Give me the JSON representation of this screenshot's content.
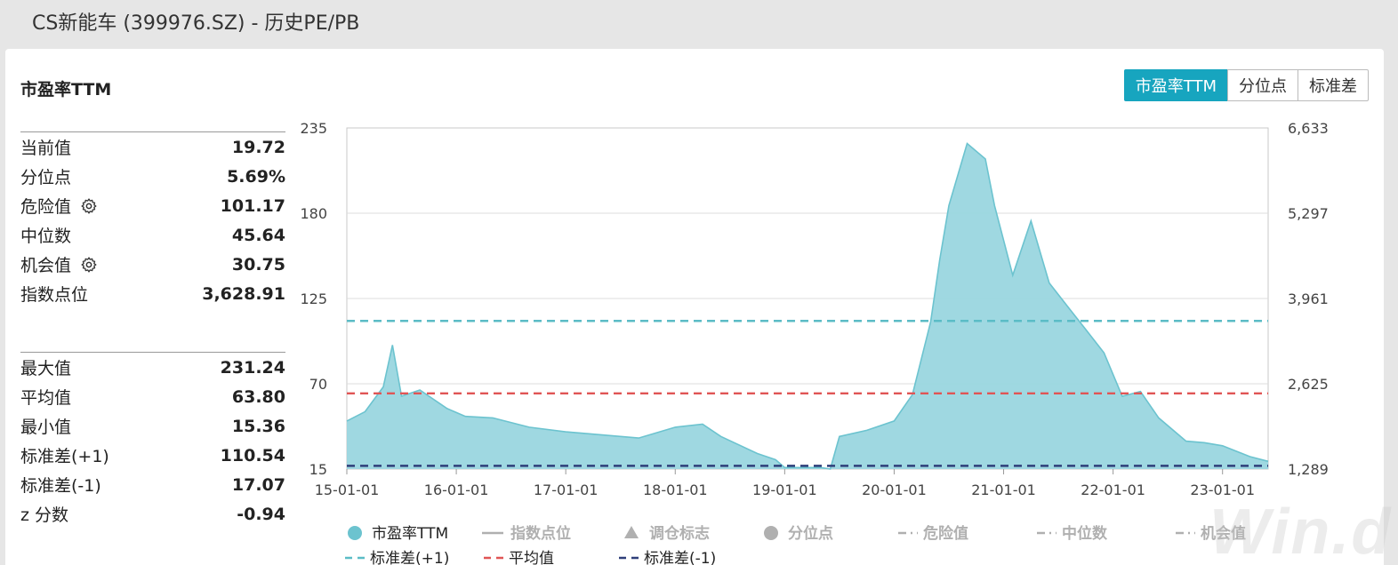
{
  "page": {
    "title": "CS新能车 (399976.SZ) - 历史PE/PB"
  },
  "panel": {
    "title": "市盈率TTM",
    "stats_top": [
      {
        "label": "当前值",
        "value": "19.72",
        "gear": false
      },
      {
        "label": "分位点",
        "value": "5.69%",
        "gear": false
      },
      {
        "label": "危险值",
        "value": "101.17",
        "gear": true
      },
      {
        "label": "中位数",
        "value": "45.64",
        "gear": false
      },
      {
        "label": "机会值",
        "value": "30.75",
        "gear": true
      },
      {
        "label": "指数点位",
        "value": "3,628.91",
        "gear": false
      }
    ],
    "stats_bottom": [
      {
        "label": "最大值",
        "value": "231.24"
      },
      {
        "label": "平均值",
        "value": "63.80"
      },
      {
        "label": "最小值",
        "value": "15.36"
      },
      {
        "label": "标准差(+1)",
        "value": "110.54"
      },
      {
        "label": "标准差(-1)",
        "value": "17.07"
      },
      {
        "label": "z 分数",
        "value": "-0.94"
      }
    ]
  },
  "toolbar": {
    "buttons": [
      {
        "label": "市盈率TTM",
        "active": true
      },
      {
        "label": "分位点",
        "active": false
      },
      {
        "label": "标准差",
        "active": false
      }
    ]
  },
  "watermark": "Win.d",
  "colors": {
    "accent": "#17a5bf",
    "area_fill": "#9ad6df",
    "area_line": "#6cc3cf",
    "std_plus": "#5bbcc6",
    "mean": "#e05555",
    "std_minus": "#2f3f7a",
    "legend_inactive": "#b0b0b0"
  },
  "chart_data": {
    "type": "area",
    "series": [
      {
        "name": "市盈率TTM",
        "x": [
          "2015-01",
          "2015-03",
          "2015-05",
          "2015-06",
          "2015-07",
          "2015-09",
          "2015-12",
          "2016-02",
          "2016-05",
          "2016-09",
          "2017-01",
          "2017-05",
          "2017-09",
          "2018-01",
          "2018-04",
          "2018-06",
          "2018-10",
          "2018-12",
          "2019-01",
          "2019-03",
          "2019-05",
          "2019-06",
          "2019-07",
          "2019-10",
          "2020-01",
          "2020-03",
          "2020-05",
          "2020-06",
          "2020-07",
          "2020-09",
          "2020-11",
          "2020-12",
          "2021-02",
          "2021-04",
          "2021-06",
          "2021-08",
          "2021-10",
          "2021-12",
          "2022-02",
          "2022-04",
          "2022-06",
          "2022-09",
          "2022-11",
          "2023-01",
          "2023-04",
          "2023-06"
        ],
        "y": [
          46,
          52,
          68,
          95,
          62,
          66,
          54,
          49,
          48,
          42,
          39,
          37,
          35,
          42,
          44,
          36,
          25,
          21,
          16,
          16,
          16,
          15,
          36,
          40,
          46,
          63,
          110,
          150,
          185,
          225,
          215,
          185,
          140,
          175,
          135,
          120,
          105,
          90,
          62,
          65,
          48,
          33,
          32,
          30,
          23,
          20
        ]
      }
    ],
    "reference_lines": [
      {
        "name": "标准差(+1)",
        "value": 110.54,
        "style": "dashed"
      },
      {
        "name": "平均值",
        "value": 63.8,
        "style": "dashed"
      },
      {
        "name": "标准差(-1)",
        "value": 17.07,
        "style": "dashed"
      }
    ],
    "ylim": [
      15,
      235
    ],
    "yticks": [
      "15",
      "70",
      "125",
      "180",
      "235"
    ],
    "y2lim": [
      1289,
      6633
    ],
    "y2ticks": [
      "1,289",
      "2,625",
      "3,961",
      "5,297",
      "6,633"
    ],
    "xlim": [
      "2015-01",
      "2023-06"
    ],
    "xticks": [
      "15-01-01",
      "16-01-01",
      "17-01-01",
      "18-01-01",
      "19-01-01",
      "20-01-01",
      "21-01-01",
      "22-01-01",
      "23-01-01"
    ],
    "grid": true,
    "legend": [
      {
        "name": "市盈率TTM",
        "marker": "circle",
        "active": true
      },
      {
        "name": "指数点位",
        "marker": "line",
        "active": false
      },
      {
        "name": "调仓标志",
        "marker": "triangle",
        "active": false
      },
      {
        "name": "分位点",
        "marker": "circle",
        "active": false
      },
      {
        "name": "危险值",
        "marker": "dashdot",
        "active": false
      },
      {
        "name": "中位数",
        "marker": "dashdot",
        "active": false
      },
      {
        "name": "机会值",
        "marker": "dashdot",
        "active": false
      },
      {
        "name": "标准差(+1)",
        "marker": "dash",
        "active": true
      },
      {
        "name": "平均值",
        "marker": "dash",
        "active": true
      },
      {
        "name": "标准差(-1)",
        "marker": "dash",
        "active": true
      }
    ],
    "legend_position": "bottom"
  }
}
